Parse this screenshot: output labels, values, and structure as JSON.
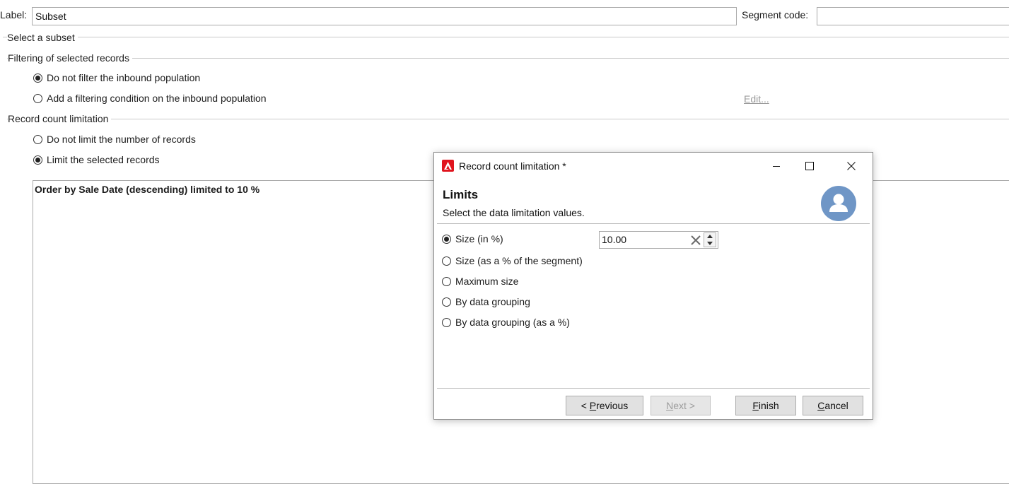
{
  "form": {
    "label_caption": "Label:",
    "label_value": "Subset",
    "segment_caption": "Segment code:",
    "segment_value": ""
  },
  "sections": {
    "select_subset": "Select a subset",
    "filtering": "Filtering of selected records",
    "record_count": "Record count limitation"
  },
  "filtering_options": [
    {
      "label": "Do not filter the inbound population",
      "checked": true
    },
    {
      "label": "Add a filtering condition on the inbound population",
      "checked": false
    }
  ],
  "edit_link": "Edit...",
  "limit_options": [
    {
      "label": "Do not limit the number of records",
      "checked": false
    },
    {
      "label": "Limit the selected records",
      "checked": true
    }
  ],
  "description": "Order by Sale Date (descending) limited to 10 %",
  "dialog": {
    "title": "Record count limitation *",
    "heading": "Limits",
    "subtitle": "Select the data limitation values.",
    "options": [
      {
        "label": "Size (in %)",
        "checked": true
      },
      {
        "label": "Size (as a % of the segment)",
        "checked": false
      },
      {
        "label": "Maximum size",
        "checked": false
      },
      {
        "label": "By data grouping",
        "checked": false
      },
      {
        "label": "By data grouping (as a %)",
        "checked": false
      }
    ],
    "size_value": "10.00",
    "buttons": {
      "previous_pre": "< ",
      "previous_acc": "P",
      "previous_rest": "revious",
      "next_acc": "N",
      "next_rest": "ext >",
      "finish_acc": "F",
      "finish_rest": "inish",
      "cancel_pre": "",
      "cancel_acc": "C",
      "cancel_rest": "ancel"
    }
  },
  "icons": {
    "app": "adobe-campaign-icon",
    "avatar": "user-avatar-icon",
    "minimize": "minimize-icon",
    "maximize": "maximize-icon",
    "close": "close-icon",
    "clear": "clear-icon",
    "spin_up": "chevron-up-icon",
    "spin_down": "chevron-down-icon"
  },
  "colors": {
    "app_icon": "#e0141e",
    "avatar": "#6f96c6"
  }
}
